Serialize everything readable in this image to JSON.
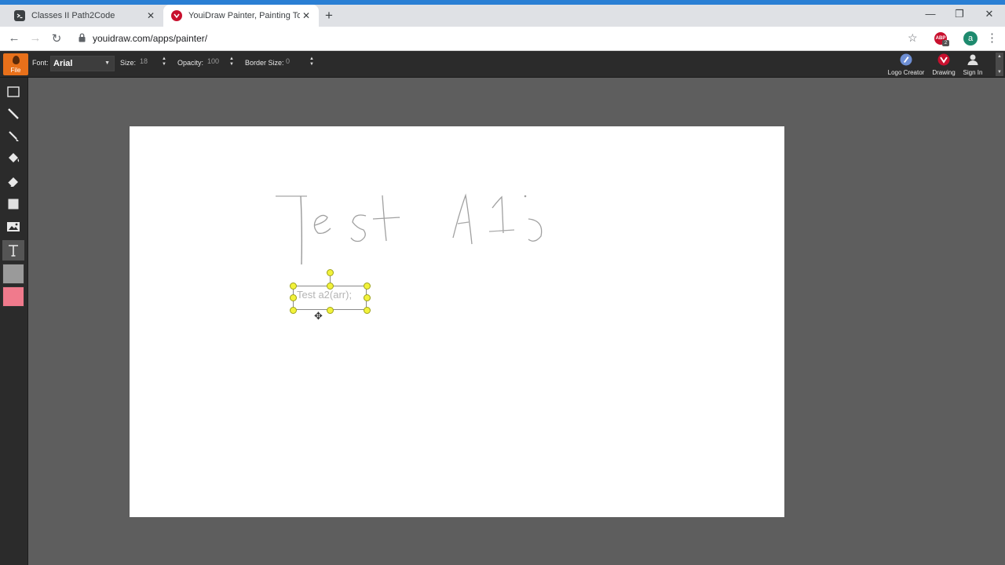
{
  "browser": {
    "tabs": [
      {
        "title": "Classes II Path2Code",
        "active": false
      },
      {
        "title": "YouiDraw Painter, Painting Tools",
        "active": true
      }
    ],
    "url": "youidraw.com/apps/painter/",
    "extension_badge": "2",
    "extension_label": "ABP",
    "profile_initial": "a"
  },
  "toolbar": {
    "file_label": "File",
    "font_label": "Font:",
    "font_value": "Arial",
    "size_label": "Size:",
    "size_value": "18",
    "opacity_label": "Opacity:",
    "opacity_value": "100",
    "border_label": "Border Size:",
    "border_value": "0",
    "nav": [
      {
        "label": "Logo Creator",
        "icon": "pen-nib-icon"
      },
      {
        "label": "Drawing",
        "icon": "drawing-logo-icon"
      },
      {
        "label": "Sign In",
        "icon": "user-icon"
      }
    ]
  },
  "tools": [
    {
      "name": "select-tool",
      "icon": "marquee-icon"
    },
    {
      "name": "pencil-tool",
      "icon": "pencil-icon"
    },
    {
      "name": "brush-tool",
      "icon": "brush-icon"
    },
    {
      "name": "fill-tool",
      "icon": "paint-bucket-icon"
    },
    {
      "name": "eraser-tool",
      "icon": "eraser-icon"
    },
    {
      "name": "shape-tool",
      "icon": "rectangle-icon"
    },
    {
      "name": "image-tool",
      "icon": "image-icon"
    },
    {
      "name": "text-tool",
      "icon": "text-icon",
      "selected": true
    }
  ],
  "colors": {
    "primary": "#9a9a9a",
    "secondary": "#f07a8c",
    "file_button": "#e8701a",
    "handle": "#f2f23a"
  },
  "canvas": {
    "handwritten_text": "Test A1;",
    "textbox_value": "Test a2(arr);"
  }
}
